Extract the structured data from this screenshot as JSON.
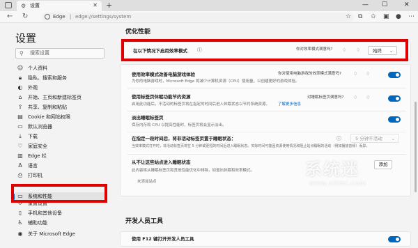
{
  "browser": {
    "tab_title": "设置",
    "new_tab": "+",
    "close_tab": "✕",
    "win_min": "—",
    "win_max": "☐",
    "win_close": "✕",
    "back": "←",
    "refresh": "↻",
    "site_name": "Edge",
    "separator": "|",
    "url": "edge://settings/system"
  },
  "sidebar": {
    "title": "设置",
    "search_placeholder": "搜索设置",
    "items": [
      {
        "label": "个人资料",
        "icon": "person-icon"
      },
      {
        "label": "隐私、搜索和服务",
        "icon": "lock-icon"
      },
      {
        "label": "外观",
        "icon": "appearance-icon"
      },
      {
        "label": "开始、主页和新建标签页",
        "icon": "home-icon"
      },
      {
        "label": "共享、复制和粘贴",
        "icon": "share-icon"
      },
      {
        "label": "Cookie 和网站权限",
        "icon": "cookie-icon"
      },
      {
        "label": "默认浏览器",
        "icon": "browser-icon"
      },
      {
        "label": "下载",
        "icon": "download-icon"
      },
      {
        "label": "家庭安全",
        "icon": "family-icon"
      },
      {
        "label": "Edge 栏",
        "icon": "edge-bar-icon"
      },
      {
        "label": "语言",
        "icon": "language-icon"
      },
      {
        "label": "打印机",
        "icon": "printer-icon"
      },
      {
        "label": "系统和性能",
        "icon": "system-icon"
      },
      {
        "label": "重置设置",
        "icon": "reset-icon"
      },
      {
        "label": "手机和其他设备",
        "icon": "phone-icon"
      },
      {
        "label": "辅助功能",
        "icon": "accessibility-icon"
      },
      {
        "label": "关于 Microsoft Edge",
        "icon": "edge-logo-icon"
      }
    ],
    "active_index": 12
  },
  "main": {
    "section_title": "优化性能",
    "efficiency": {
      "title": "在以下情况下启用效率模式",
      "question": "你对效率模式满意吗?",
      "select_value": "始终"
    },
    "gaming": {
      "title": "使用效率模式改善电脑游戏体验",
      "desc": "为你的电脑游戏时，Microsoft Edge 将减少计算机资源（CPU）使用量，以创建更好的游戏体验。",
      "question": "你对使用电脑游戏的效率模式满意吗?"
    },
    "sleeping": {
      "title": "使用标签页休眠功能节约资源",
      "desc": "启用此功能后，不活动的标签页将在指定的时间后进入休眠状态以节约系统资源。",
      "link": "了解更多信息",
      "question": "对睡眠标签页满意吗?"
    },
    "fade": {
      "title": "淡出睡眠标签页",
      "desc": "保存内存和 CPU 以提高性能时，标签页将会显示淡出。"
    },
    "inactive": {
      "title": "在指定一段时间后，将非活动标签页置于睡眠状态：",
      "desc": "当效率模式打开时，非活动标签页将在 5 分钟或更短的时间后进入睡眠状态。实际时间可能因资源使用情况和阻止站点睡眠的活动（例如播放音频）而异。",
      "select_value": "5 分钟不活动"
    },
    "never": {
      "title": "从不让这些站点进入睡眠状态",
      "desc": "此内容将从睡眠标签页和其他性能优化中排除，如退出休眠和效率模式。",
      "empty": "未添加站点",
      "button": "添加"
    },
    "dev_section_title": "开发人员工具",
    "f12": {
      "title": "使用 F12 键打开开发人员工具"
    },
    "colors": {
      "accent": "#0067c0",
      "highlight": "#e00000"
    }
  },
  "watermark": {
    "text": "系统迷",
    "url": "www.xitmi.com"
  }
}
